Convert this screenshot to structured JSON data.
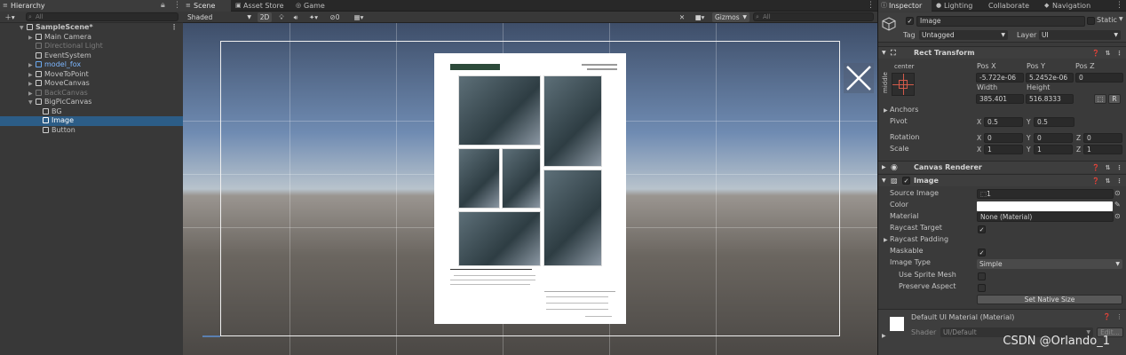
{
  "hierarchy": {
    "tab": "Hierarchy",
    "search_placeholder": "All",
    "rows": [
      {
        "label": "SampleScene*",
        "indent": 0
      },
      {
        "label": "Main Camera"
      },
      {
        "label": "Directional Light"
      },
      {
        "label": "EventSystem"
      },
      {
        "label": "model_fox"
      },
      {
        "label": "MoveToPoint"
      },
      {
        "label": "MoveCanvas"
      },
      {
        "label": "BackCanvas"
      },
      {
        "label": "BigPicCanvas"
      },
      {
        "label": "BG"
      },
      {
        "label": "Image"
      },
      {
        "label": "Button"
      }
    ]
  },
  "scene": {
    "tabs": [
      "Scene",
      "Asset Store",
      "Game"
    ],
    "shading": "Shaded",
    "mode_2d": "2D",
    "gizmos": "Gizmos",
    "search_placeholder": "All",
    "audio_count": "0"
  },
  "inspector": {
    "tabs": [
      "Inspector",
      "Lighting",
      "Collaborate",
      "Navigation"
    ],
    "object_name": "Image",
    "static_label": "Static",
    "tag_label": "Tag",
    "tag_value": "Untagged",
    "layer_label": "Layer",
    "layer_value": "UI",
    "rect_transform": {
      "title": "Rect Transform",
      "anchor_h": "center",
      "anchor_v": "middle",
      "pos_x_label": "Pos X",
      "pos_x": "-5.722e-06",
      "pos_y_label": "Pos Y",
      "pos_y": "5.2452e-06",
      "pos_z_label": "Pos Z",
      "pos_z": "0",
      "width_label": "Width",
      "width": "385.401",
      "height_label": "Height",
      "height": "516.8333",
      "r_button": "R",
      "anchors_label": "Anchors",
      "pivot_label": "Pivot",
      "pivot_x": "0.5",
      "pivot_y": "0.5",
      "rotation_label": "Rotation",
      "rot_x": "0",
      "rot_y": "0",
      "rot_z": "0",
      "scale_label": "Scale",
      "scale_x": "1",
      "scale_y": "1",
      "scale_z": "1",
      "x": "X",
      "y": "Y",
      "z": "Z"
    },
    "canvas_renderer": {
      "title": "Canvas Renderer"
    },
    "image": {
      "title": "Image",
      "source_image_label": "Source Image",
      "source_image": "1",
      "color_label": "Color",
      "material_label": "Material",
      "material": "None (Material)",
      "raycast_target_label": "Raycast Target",
      "raycast_padding_label": "Raycast Padding",
      "maskable_label": "Maskable",
      "image_type_label": "Image Type",
      "image_type": "Simple",
      "use_sprite_mesh_label": "Use Sprite Mesh",
      "preserve_aspect_label": "Preserve Aspect",
      "set_native_size": "Set Native Size"
    },
    "material_footer": {
      "title": "Default UI Material (Material)",
      "shader_label": "Shader",
      "shader_value": "UI/Default",
      "edit_button": "Edit..."
    }
  },
  "watermark": "CSDN @Orlando_1",
  "colors": {
    "selection": "#2c5d87",
    "panel": "#383838",
    "accent_blue": "#7db7ff"
  }
}
